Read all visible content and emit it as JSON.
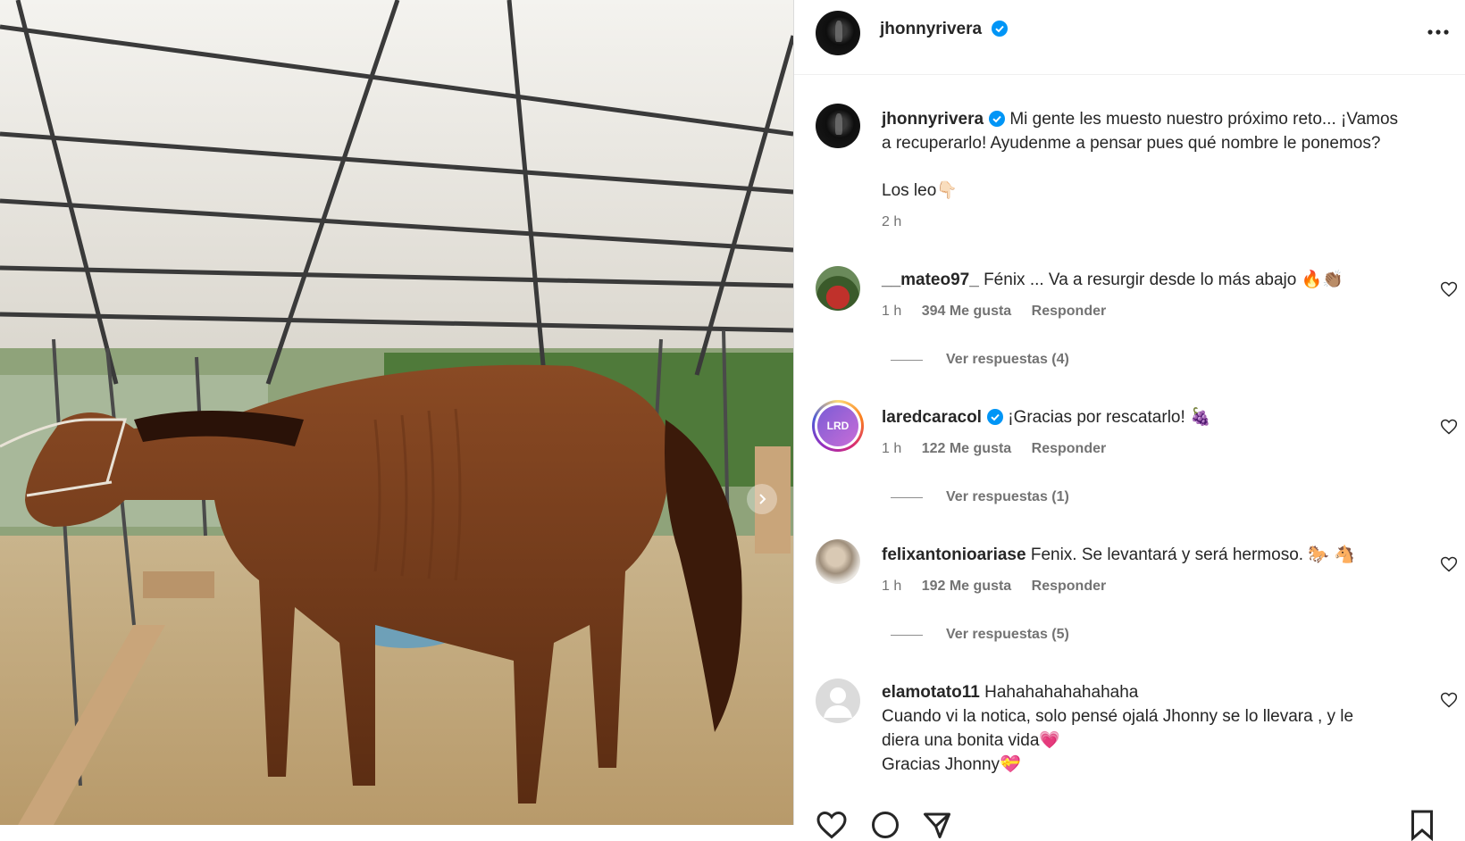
{
  "post": {
    "author": "jhonnyrivera",
    "more_icon": "more-options-icon",
    "caption_line1": "Mi gente les muesto nuestro próximo reto... ¡Vamos",
    "caption_line2": "a recuperarlo! Ayudenme a pensar pues qué nombre le ponemos?",
    "caption_line3": "Los leo👇🏻",
    "caption_time": "2 h"
  },
  "comments": [
    {
      "user": "__mateo97_",
      "verified": false,
      "text": "Fénix ... Va a resurgir desde lo más abajo 🔥👏🏽",
      "time": "1 h",
      "likes": "394 Me gusta",
      "reply": "Responder",
      "view_replies": "Ver respuestas (4)"
    },
    {
      "user": "laredcaracol",
      "verified": true,
      "avatar_text": "LRD",
      "text": "¡Gracias por rescatarlo! 🍇",
      "time": "1 h",
      "likes": "122 Me gusta",
      "reply": "Responder",
      "view_replies": "Ver respuestas (1)"
    },
    {
      "user": "felixantonioariase",
      "verified": false,
      "text": "Fenix. Se levantará y será hermoso. 🐎 🐴",
      "time": "1 h",
      "likes": "192 Me gusta",
      "reply": "Responder",
      "view_replies": "Ver respuestas (5)"
    },
    {
      "user": "elamotato11",
      "verified": false,
      "text_line1": "Hahahahahahahaha",
      "text_line2": "Cuando vi la notica, solo pensé ojalá Jhonny se lo llevara , y le",
      "text_line3": "diera una bonita vida💗",
      "text_line4": "Gracias Jhonny💝"
    }
  ],
  "colors": {
    "verified_blue": "#0095f6",
    "text_primary": "#262626",
    "text_secondary": "#737373"
  }
}
